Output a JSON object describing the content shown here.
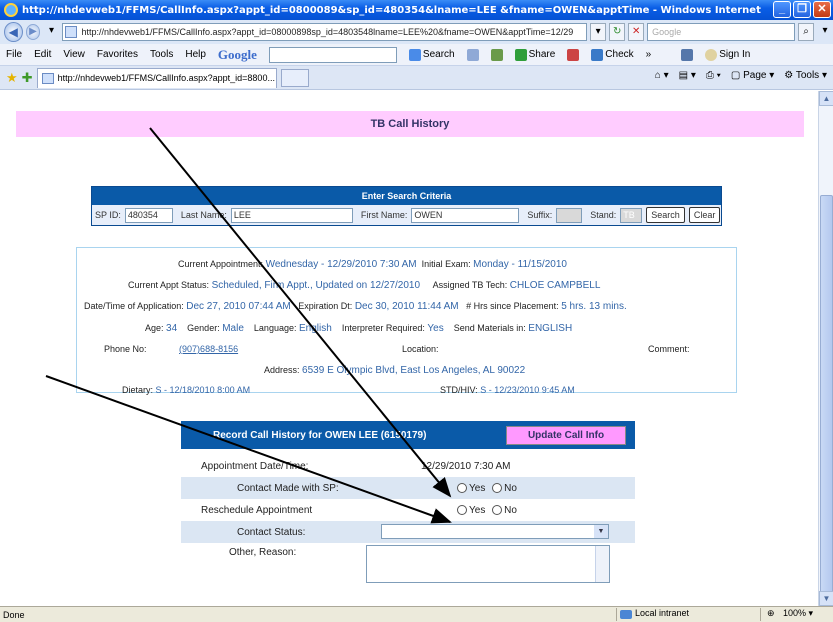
{
  "window": {
    "title": "http://nhdevweb1/FFMS/CallInfo.aspx?appt_id=0800089&sp_id=480354&lname=LEE &fname=OWEN&apptTime - Windows Internet Explorer"
  },
  "browser": {
    "address": "http://nhdevweb1/FFMS/CallInfo.aspx?appt_id=08000898sp_id=4803548lname=LEE%20&fname=OWEN&apptTime=12/29",
    "search_placeholder": "Google",
    "menu": [
      "File",
      "Edit",
      "View",
      "Favorites",
      "Tools",
      "Help"
    ],
    "google_label": "Google",
    "toolbar": {
      "search": "Search",
      "share": "Share",
      "check": "Check",
      "more": "»",
      "signin": "Sign In"
    },
    "tab_title": "http://nhdevweb1/FFMS/CallInfo.aspx?appt_id=8800...",
    "page_menu": "Page",
    "tools_menu": "Tools"
  },
  "page": {
    "header": "TB Call History",
    "search": {
      "title": "Enter Search Criteria",
      "sp_id_label": "SP ID:",
      "sp_id": "480354",
      "last_name_label": "Last Name:",
      "last_name": "LEE",
      "first_name_label": "First Name:",
      "first_name": "OWEN",
      "suffix_label": "Suffix:",
      "stand_label": "Stand:",
      "stand": "TB",
      "search_button": "Search",
      "clear_button": "Clear"
    },
    "info": {
      "current_appt_label": "Current Appointment:",
      "current_appt": "Wednesday - 12/29/2010 7:30 AM",
      "initial_exam_label": "Initial Exam:",
      "initial_exam": "Monday - 11/15/2010",
      "status_label": "Current Appt Status:",
      "status": "Scheduled, Firm Appt., Updated on 12/27/2010",
      "tech_label": "Assigned TB Tech:",
      "tech": "CHLOE CAMPBELL",
      "app_date_label": "Date/Time of Application:",
      "app_date": "Dec 27, 2010 07:44 AM",
      "expiration_label": "Expiration Dt:",
      "expiration": "Dec 30, 2010 11:44 AM",
      "hrs_label": "# Hrs since Placement:",
      "hrs": "5 hrs. 13 mins.",
      "age_label": "Age:",
      "age": "34",
      "gender_label": "Gender:",
      "gender": "Male",
      "language_label": "Language:",
      "language": "English",
      "interp_label": "Interpreter Required:",
      "interp": "Yes",
      "send_label": "Send Materials in:",
      "send": "ENGLISH",
      "phone_label": "Phone No:",
      "phone": "(907)688-8156",
      "location_label": "Location:",
      "comment_label": "Comment:",
      "address_label": "Address:",
      "address": "6539 E Olympic Blvd, East Los Angeles, AL 90022",
      "dietary_label": "Dietary:",
      "dietary": "S - 12/18/2010 8:00 AM",
      "std_label": "STD/HIV:",
      "std": "S - 12/23/2010 9:45 AM"
    },
    "record": {
      "title": "Record Call History for OWEN LEE (6150179)",
      "update_button": "Update Call Info",
      "appt_label": "Appointment Date/Time:",
      "appt_value": "12/29/2010 7:30 AM",
      "contact_label": "Contact Made with SP:",
      "reschedule_label": "Reschedule Appointment",
      "yes": "Yes",
      "no": "No",
      "contact_status_label": "Contact Status:",
      "other_reason_label": "Other, Reason:"
    }
  },
  "status": {
    "left": "Done",
    "zone": "Local intranet",
    "zoom": "100%"
  }
}
